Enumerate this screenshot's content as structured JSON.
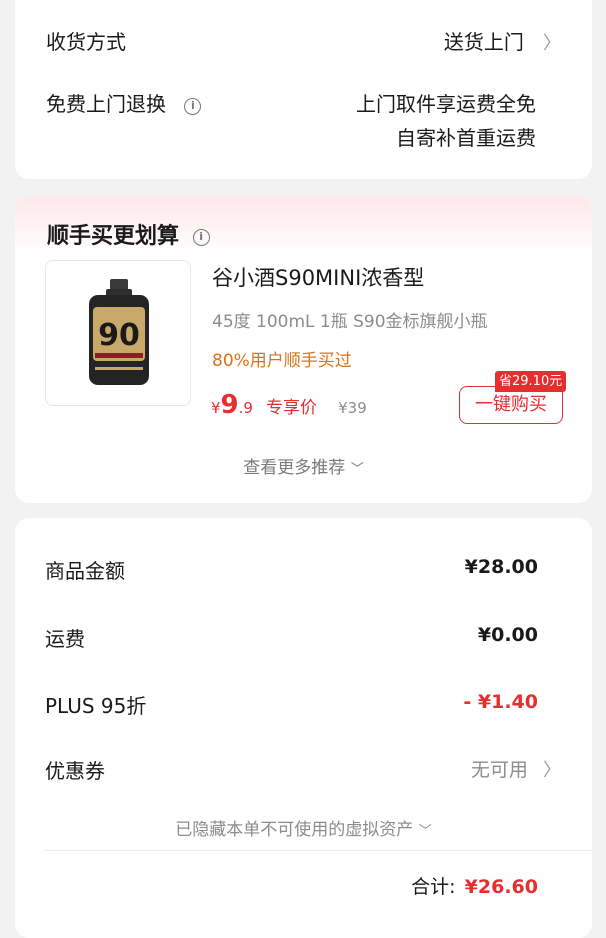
{
  "delivery": {
    "method_label": "收货方式",
    "method_value": "送货上门",
    "return_label": "免费上门退换",
    "return_line1": "上门取件享运费全免",
    "return_line2": "自寄补首重运费"
  },
  "bundle": {
    "title": "顺手买更划算",
    "product": {
      "name": "谷小酒S90MINI浓香型",
      "spec": "45度 100mL 1瓶 S90金标旗舰小瓶",
      "social_proof": "80%用户顺手买过",
      "price_symbol": "¥",
      "price_int": "9",
      "price_dec": ".9",
      "price_tag": "专享价",
      "original_price": "¥39",
      "save_badge": "省29.10元",
      "buy_label": "一键购买",
      "bottle_number": "90"
    },
    "more_label": "查看更多推荐"
  },
  "summary": {
    "rows": [
      {
        "label": "商品金额",
        "value": "¥28.00"
      },
      {
        "label": "运费",
        "value": "¥0.00"
      },
      {
        "label": "PLUS 95折",
        "value": "- ¥1.40"
      },
      {
        "label": "优惠券",
        "value": "无可用"
      }
    ],
    "hidden_note": "已隐藏本单不可使用的虚拟资产",
    "total_label": "合计:",
    "total_value": "¥26.60"
  },
  "colors": {
    "accent_red": "#e62e2e",
    "accent_orange": "#d9731a",
    "background": "#f2f2f2"
  }
}
